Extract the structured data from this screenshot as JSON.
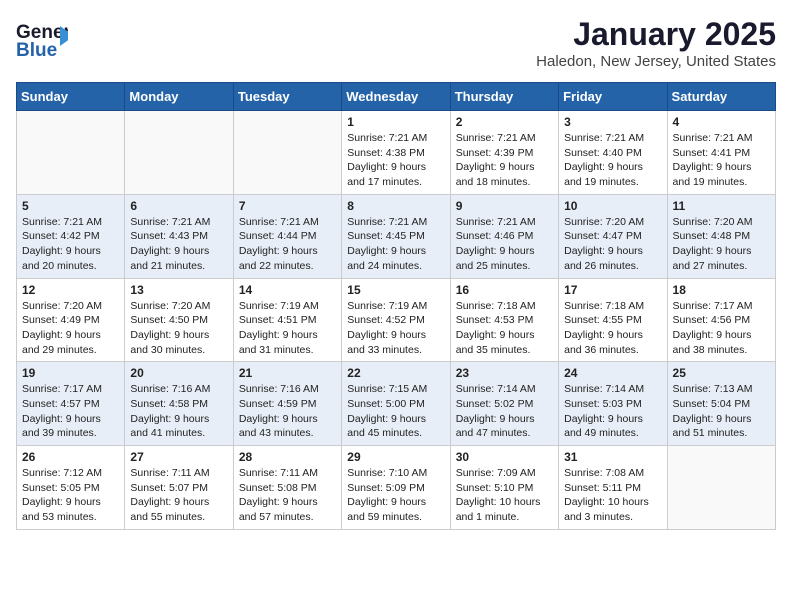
{
  "logo": {
    "line1": "General",
    "line2": "Blue",
    "arrow_color": "#3a8fd4"
  },
  "title": "January 2025",
  "subtitle": "Haledon, New Jersey, United States",
  "weekdays": [
    "Sunday",
    "Monday",
    "Tuesday",
    "Wednesday",
    "Thursday",
    "Friday",
    "Saturday"
  ],
  "weeks": [
    [
      {
        "day": "",
        "info": ""
      },
      {
        "day": "",
        "info": ""
      },
      {
        "day": "",
        "info": ""
      },
      {
        "day": "1",
        "info": "Sunrise: 7:21 AM\nSunset: 4:38 PM\nDaylight: 9 hours\nand 17 minutes."
      },
      {
        "day": "2",
        "info": "Sunrise: 7:21 AM\nSunset: 4:39 PM\nDaylight: 9 hours\nand 18 minutes."
      },
      {
        "day": "3",
        "info": "Sunrise: 7:21 AM\nSunset: 4:40 PM\nDaylight: 9 hours\nand 19 minutes."
      },
      {
        "day": "4",
        "info": "Sunrise: 7:21 AM\nSunset: 4:41 PM\nDaylight: 9 hours\nand 19 minutes."
      }
    ],
    [
      {
        "day": "5",
        "info": "Sunrise: 7:21 AM\nSunset: 4:42 PM\nDaylight: 9 hours\nand 20 minutes."
      },
      {
        "day": "6",
        "info": "Sunrise: 7:21 AM\nSunset: 4:43 PM\nDaylight: 9 hours\nand 21 minutes."
      },
      {
        "day": "7",
        "info": "Sunrise: 7:21 AM\nSunset: 4:44 PM\nDaylight: 9 hours\nand 22 minutes."
      },
      {
        "day": "8",
        "info": "Sunrise: 7:21 AM\nSunset: 4:45 PM\nDaylight: 9 hours\nand 24 minutes."
      },
      {
        "day": "9",
        "info": "Sunrise: 7:21 AM\nSunset: 4:46 PM\nDaylight: 9 hours\nand 25 minutes."
      },
      {
        "day": "10",
        "info": "Sunrise: 7:20 AM\nSunset: 4:47 PM\nDaylight: 9 hours\nand 26 minutes."
      },
      {
        "day": "11",
        "info": "Sunrise: 7:20 AM\nSunset: 4:48 PM\nDaylight: 9 hours\nand 27 minutes."
      }
    ],
    [
      {
        "day": "12",
        "info": "Sunrise: 7:20 AM\nSunset: 4:49 PM\nDaylight: 9 hours\nand 29 minutes."
      },
      {
        "day": "13",
        "info": "Sunrise: 7:20 AM\nSunset: 4:50 PM\nDaylight: 9 hours\nand 30 minutes."
      },
      {
        "day": "14",
        "info": "Sunrise: 7:19 AM\nSunset: 4:51 PM\nDaylight: 9 hours\nand 31 minutes."
      },
      {
        "day": "15",
        "info": "Sunrise: 7:19 AM\nSunset: 4:52 PM\nDaylight: 9 hours\nand 33 minutes."
      },
      {
        "day": "16",
        "info": "Sunrise: 7:18 AM\nSunset: 4:53 PM\nDaylight: 9 hours\nand 35 minutes."
      },
      {
        "day": "17",
        "info": "Sunrise: 7:18 AM\nSunset: 4:55 PM\nDaylight: 9 hours\nand 36 minutes."
      },
      {
        "day": "18",
        "info": "Sunrise: 7:17 AM\nSunset: 4:56 PM\nDaylight: 9 hours\nand 38 minutes."
      }
    ],
    [
      {
        "day": "19",
        "info": "Sunrise: 7:17 AM\nSunset: 4:57 PM\nDaylight: 9 hours\nand 39 minutes."
      },
      {
        "day": "20",
        "info": "Sunrise: 7:16 AM\nSunset: 4:58 PM\nDaylight: 9 hours\nand 41 minutes."
      },
      {
        "day": "21",
        "info": "Sunrise: 7:16 AM\nSunset: 4:59 PM\nDaylight: 9 hours\nand 43 minutes."
      },
      {
        "day": "22",
        "info": "Sunrise: 7:15 AM\nSunset: 5:00 PM\nDaylight: 9 hours\nand 45 minutes."
      },
      {
        "day": "23",
        "info": "Sunrise: 7:14 AM\nSunset: 5:02 PM\nDaylight: 9 hours\nand 47 minutes."
      },
      {
        "day": "24",
        "info": "Sunrise: 7:14 AM\nSunset: 5:03 PM\nDaylight: 9 hours\nand 49 minutes."
      },
      {
        "day": "25",
        "info": "Sunrise: 7:13 AM\nSunset: 5:04 PM\nDaylight: 9 hours\nand 51 minutes."
      }
    ],
    [
      {
        "day": "26",
        "info": "Sunrise: 7:12 AM\nSunset: 5:05 PM\nDaylight: 9 hours\nand 53 minutes."
      },
      {
        "day": "27",
        "info": "Sunrise: 7:11 AM\nSunset: 5:07 PM\nDaylight: 9 hours\nand 55 minutes."
      },
      {
        "day": "28",
        "info": "Sunrise: 7:11 AM\nSunset: 5:08 PM\nDaylight: 9 hours\nand 57 minutes."
      },
      {
        "day": "29",
        "info": "Sunrise: 7:10 AM\nSunset: 5:09 PM\nDaylight: 9 hours\nand 59 minutes."
      },
      {
        "day": "30",
        "info": "Sunrise: 7:09 AM\nSunset: 5:10 PM\nDaylight: 10 hours\nand 1 minute."
      },
      {
        "day": "31",
        "info": "Sunrise: 7:08 AM\nSunset: 5:11 PM\nDaylight: 10 hours\nand 3 minutes."
      },
      {
        "day": "",
        "info": ""
      }
    ]
  ]
}
